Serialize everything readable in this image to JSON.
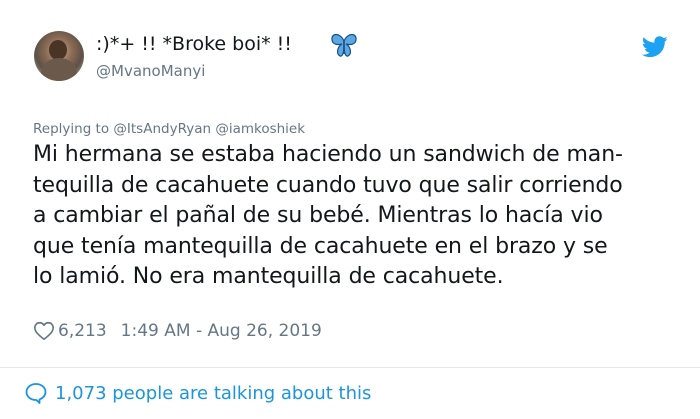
{
  "user": {
    "display_name": ":)*+ !! *Broke boi* !! ",
    "handle": "@MvanoManyi"
  },
  "icons": {
    "avatar": "user-photo",
    "badge": "butterfly-icon",
    "brand": "twitter-bird-icon",
    "like": "heart-icon",
    "comments": "speech-bubble-icon"
  },
  "colors": {
    "brand_blue": "#1da1f2",
    "link_blue": "#1b95e0",
    "secondary_text": "#657786",
    "butterfly": "#4a90d9"
  },
  "reply": {
    "prefix": "Replying to",
    "mentions": "@ItsAndyRyan @iamkoshiek"
  },
  "tweet": {
    "lines": [
      "Mi hermana se estaba haciendo un sandwich de man-",
      "tequilla de cacahuete cuando tuvo que salir corriendo",
      "a cambiar el pañal de su bebé. Mientras lo hacía vio",
      "que tenía mantequilla de cacahuete en el brazo y se",
      "lo lamió. No era mantequilla de cacahuete."
    ]
  },
  "meta": {
    "likes": "6,213",
    "timestamp": "1:49 AM - Aug 26, 2019"
  },
  "footer": {
    "talking": "1,073 people are talking about this"
  }
}
